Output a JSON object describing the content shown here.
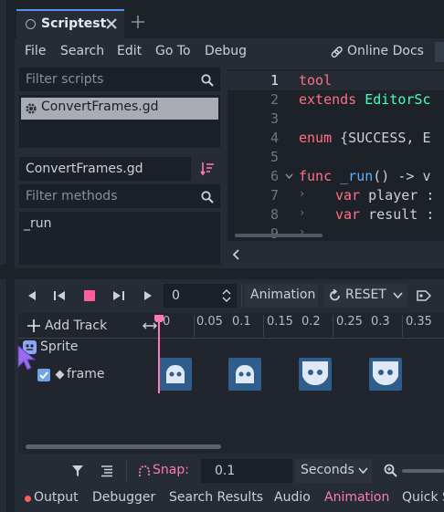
{
  "tab": {
    "title": "Scriptest"
  },
  "menu": {
    "file": "File",
    "search": "Search",
    "edit": "Edit",
    "goto": "Go To",
    "debug": "Debug",
    "online_docs": "Online Docs"
  },
  "scripts": {
    "filter_placeholder": "Filter scripts",
    "items": [
      "ConvertFrames.gd"
    ],
    "current": "ConvertFrames.gd",
    "methods_placeholder": "Filter methods",
    "methods": [
      "_run"
    ]
  },
  "code": {
    "line_numbers": [
      "1",
      "2",
      "3",
      "4",
      "5",
      "6",
      "7",
      "8",
      "9"
    ],
    "l1": "tool",
    "l2_kw": "extends",
    "l2_ty": "EditorSc",
    "l4_kw": "enum",
    "l4_rest": "{SUCCESS, E",
    "l6_kw": "func",
    "l6_fn": "_run",
    "l6_rest": "() -> v",
    "l7_kw": "var",
    "l7_rest": "player :",
    "l8_kw": "var",
    "l8_rest": "result :"
  },
  "animation": {
    "frame_value": "0",
    "animation_label": "Animation",
    "reset_label": "RESET",
    "add_track": "Add Track",
    "ticks": [
      "0",
      "0.05",
      "0.1",
      "0.15",
      "0.2",
      "0.25",
      "0.3",
      "0.35"
    ],
    "track_node": "Sprite",
    "track_property": "frame",
    "snap_label": "Snap:",
    "snap_value": "0.1",
    "snap_unit": "Seconds"
  },
  "bottom_panel": {
    "tabs": [
      "Output",
      "Debugger",
      "Search Results",
      "Audio",
      "Animation",
      "Quick S"
    ],
    "active": "Animation"
  },
  "colors": {
    "accent": "#ff7ab2",
    "record": "#ff5e99",
    "key": "#2f5d8c",
    "output_dot": "#ff5d5d"
  }
}
